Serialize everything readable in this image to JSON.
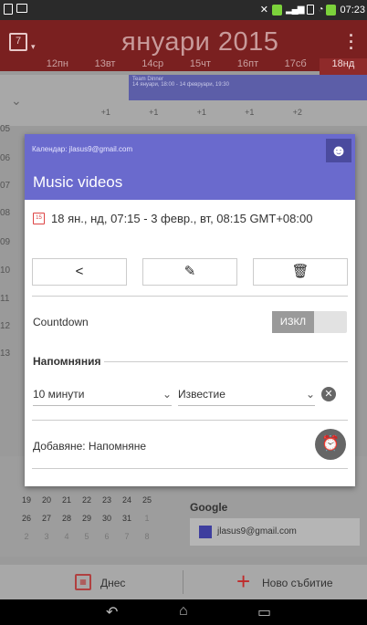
{
  "status_bar": {
    "time": "07:23"
  },
  "header": {
    "title": "януари 2015",
    "calendar_day": "7"
  },
  "week": [
    {
      "num": "12",
      "name": "пн"
    },
    {
      "num": "13",
      "name": "вт"
    },
    {
      "num": "14",
      "name": "ср"
    },
    {
      "num": "15",
      "name": "чт"
    },
    {
      "num": "16",
      "name": "пт"
    },
    {
      "num": "17",
      "name": "сб"
    },
    {
      "num": "18",
      "name": "нд"
    }
  ],
  "allday": {
    "event_title": "Team Dinner",
    "event_time": "14 януари, 18:00 - 14 февруари, 19:30",
    "more": [
      "+1",
      "+1",
      "+1",
      "+1",
      "+2"
    ]
  },
  "hours": [
    "05",
    "06",
    "07",
    "08",
    "09",
    "10",
    "11",
    "12",
    "13"
  ],
  "dialog": {
    "account": "Календар: jlasus9@gmail.com",
    "event_title": "Music videos",
    "datetime": "18 ян., нд, 07:15 - 3 февр., вт, 08:15  GMT+08:00",
    "countdown_label": "Countdown",
    "countdown_state": "ИЗКЛ",
    "reminders_title": "Напомняния",
    "reminder_time": "10 минути",
    "reminder_type": "Известие",
    "add_reminder": "Добавяне: Напомняне",
    "accent_color": "#6a6acd"
  },
  "mini_calendar": {
    "rows": [
      [
        "19",
        "20",
        "21",
        "22",
        "23",
        "24",
        "25"
      ],
      [
        "26",
        "27",
        "28",
        "29",
        "30",
        "31",
        "1"
      ],
      [
        "2",
        "3",
        "4",
        "5",
        "6",
        "7",
        "8"
      ]
    ]
  },
  "calendars": {
    "group": "Google",
    "account": "jlasus9@gmail.com"
  },
  "bottom_bar": {
    "today_label": "Днес",
    "new_event_label": "Ново събитие"
  }
}
